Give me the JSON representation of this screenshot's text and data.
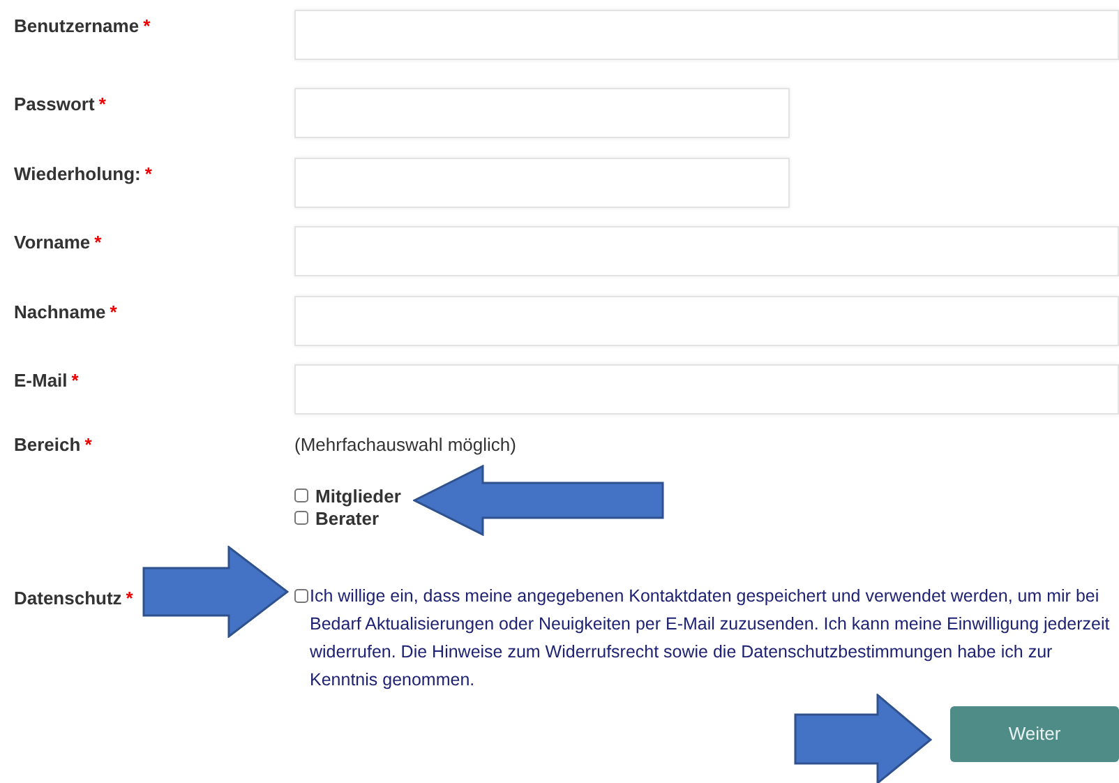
{
  "fields": [
    {
      "label": "Benutzername",
      "required": "*",
      "wide": true
    },
    {
      "label": "Passwort",
      "required": "*",
      "wide": false
    },
    {
      "label": "Wiederholung:",
      "required": "*",
      "wide": false
    },
    {
      "label": "Vorname",
      "required": "*",
      "wide": true
    },
    {
      "label": "Nachname",
      "required": "*",
      "wide": true
    },
    {
      "label": "E-Mail",
      "required": "*",
      "wide": true
    }
  ],
  "bereich": {
    "label": "Bereich",
    "required": "*",
    "hint": "(Mehrfachauswahl möglich)",
    "options": [
      {
        "label": "Mitglieder",
        "checked": false
      },
      {
        "label": "Berater",
        "checked": false
      }
    ]
  },
  "datenschutz": {
    "label": "Datenschutz",
    "required": "*",
    "checked": false,
    "text": "Ich willige ein, dass meine angegebenen Kontaktdaten gespeichert und verwendet werden, um mir bei Bedarf Aktualisierungen oder Neuigkeiten per E-Mail zuzusenden. Ich kann meine Einwilligung jederzeit widerrufen. Die Hinweise zum Widerrufsrecht sowie die Datenschutzbestimmungen habe ich zur Kenntnis genommen."
  },
  "submit": {
    "label": "Weiter"
  }
}
